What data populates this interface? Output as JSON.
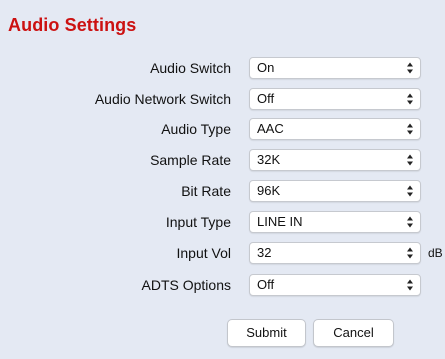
{
  "title": "Audio Settings",
  "fields": [
    {
      "label": "Audio Switch",
      "value": "On"
    },
    {
      "label": "Audio Network Switch",
      "value": "Off"
    },
    {
      "label": "Audio Type",
      "value": "AAC"
    },
    {
      "label": "Sample Rate",
      "value": "32K"
    },
    {
      "label": "Bit Rate",
      "value": "96K"
    },
    {
      "label": "Input Type",
      "value": "LINE IN"
    },
    {
      "label": "Input Vol",
      "value": "32",
      "unit": "dB"
    },
    {
      "label": "ADTS Options",
      "value": "Off"
    }
  ],
  "buttons": {
    "submit": "Submit",
    "cancel": "Cancel"
  },
  "icons": {
    "select_arrows": "up-down-chevron-icon"
  },
  "colors": {
    "title": "#cc1111",
    "background": "#e4e9f3"
  }
}
